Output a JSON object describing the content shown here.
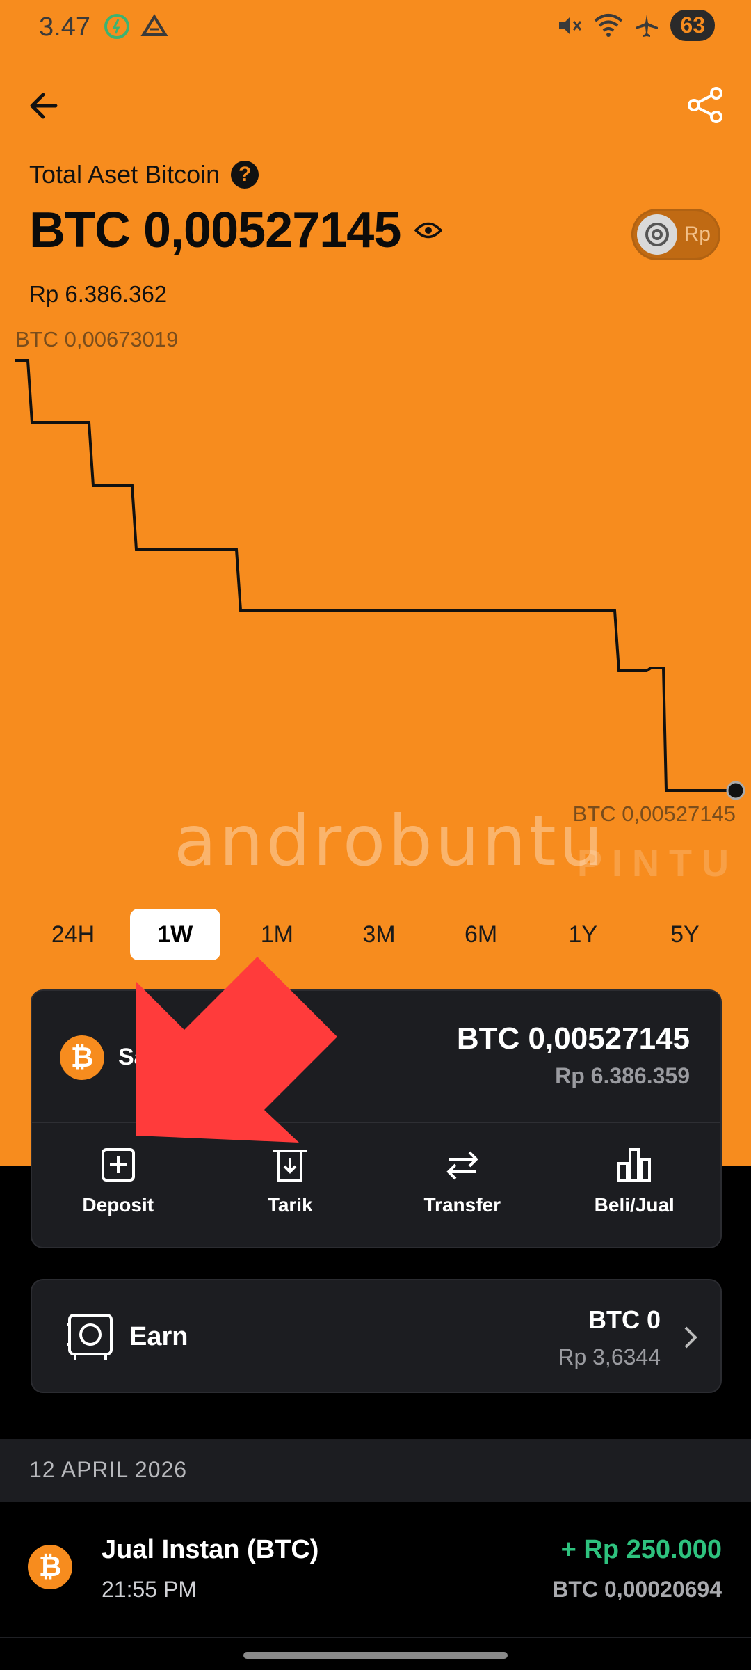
{
  "status_bar": {
    "time": "3.47",
    "battery": "63",
    "icons": [
      "data-saver-icon",
      "drive-icon",
      "mute-icon",
      "wifi-icon",
      "airplane-icon"
    ]
  },
  "header": {
    "back_icon": "arrow-left-icon",
    "share_icon": "share-icon"
  },
  "asset": {
    "title": "Total Aset Bitcoin",
    "help_label": "?",
    "balance": "BTC 0,00527145",
    "fiat_value": "Rp 6.386.362",
    "toggle_label": "Rp"
  },
  "chart_data": {
    "type": "line",
    "max_label": "BTC 0,00673019",
    "min_label": "BTC 0,00527145",
    "y_values": [
      0.00673019,
      0.00648,
      0.00624,
      0.00599,
      0.00575,
      0.00552,
      0.00551,
      0.00527145
    ],
    "line_color": "#111111"
  },
  "watermark": {
    "text": "androbuntu",
    "text2": "PINTU"
  },
  "timeframes": [
    "24H",
    "1W",
    "1M",
    "3M",
    "6M",
    "1Y",
    "5Y"
  ],
  "active_timeframe": "1W",
  "wallet_card": {
    "logo": "₿",
    "label": "Sa",
    "btc": "BTC 0,00527145",
    "fiat": "Rp 6.386.359",
    "actions": [
      {
        "label": "Deposit",
        "icon": "plus-square-icon"
      },
      {
        "label": "Tarik",
        "icon": "withdraw-icon"
      },
      {
        "label": "Transfer",
        "icon": "transfer-icon"
      },
      {
        "label": "Beli/Jual",
        "icon": "bar-chart-icon"
      }
    ]
  },
  "earn": {
    "label": "Earn",
    "btc": "BTC 0",
    "fiat": "Rp 3,6344"
  },
  "history": {
    "date": "12 APRIL 2026",
    "transactions": [
      {
        "logo": "₿",
        "title": "Jual Instan (BTC)",
        "time": "21:55 PM",
        "amount": "+ Rp 250.000",
        "btc": "BTC 0,00020694"
      }
    ]
  },
  "colors": {
    "accent": "#F78C1E",
    "card": "#1C1D21",
    "positive": "#2EC27E",
    "arrow": "#FF3B3B"
  }
}
